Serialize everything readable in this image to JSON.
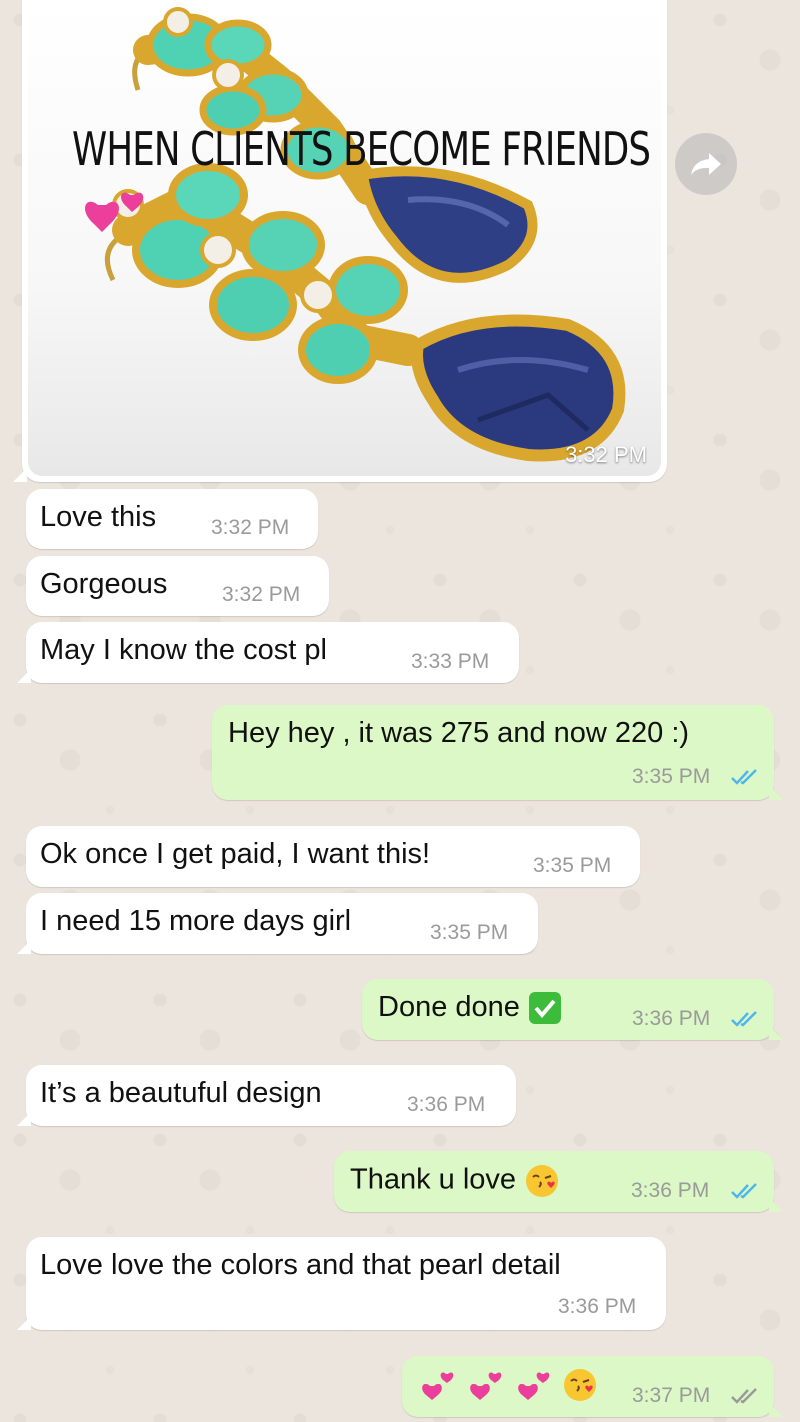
{
  "chat": {
    "image_message": {
      "caption": "WHEN CLIENTS BECOME FRIENDS",
      "time": "3:32 PM"
    },
    "messages": [
      {
        "text": "Love this",
        "time": "3:32 PM"
      },
      {
        "text": "Gorgeous",
        "time": "3:32 PM"
      },
      {
        "text": "May I know the cost pl",
        "time": "3:33 PM"
      },
      {
        "text": "Hey hey , it was 275 and now 220 :)",
        "time": "3:35 PM"
      },
      {
        "text": "Ok once I get paid, I want this!",
        "time": "3:35 PM"
      },
      {
        "text": "I need 15 more days girl",
        "time": "3:35 PM"
      },
      {
        "text": "Done done",
        "time": "3:36 PM"
      },
      {
        "text": "It’s a beautuful design",
        "time": "3:36 PM"
      },
      {
        "text": "Thank u love",
        "time": "3:36 PM"
      },
      {
        "text": "Love love the colors and that pearl detail",
        "time": "3:36 PM"
      },
      {
        "text": "",
        "time": "3:37 PM"
      }
    ]
  },
  "colors": {
    "incoming_bubble": "#ffffff",
    "outgoing_bubble": "#dcf8c6",
    "read_check": "#4fb6ec",
    "delivered_check": "#9a9a9a",
    "wallpaper": "#ece5dd"
  },
  "icons": [
    "forward-icon",
    "read-receipt-icon",
    "delivered-icon",
    "check-mark-emoji",
    "kissing-face-emoji",
    "two-hearts-emoji"
  ]
}
